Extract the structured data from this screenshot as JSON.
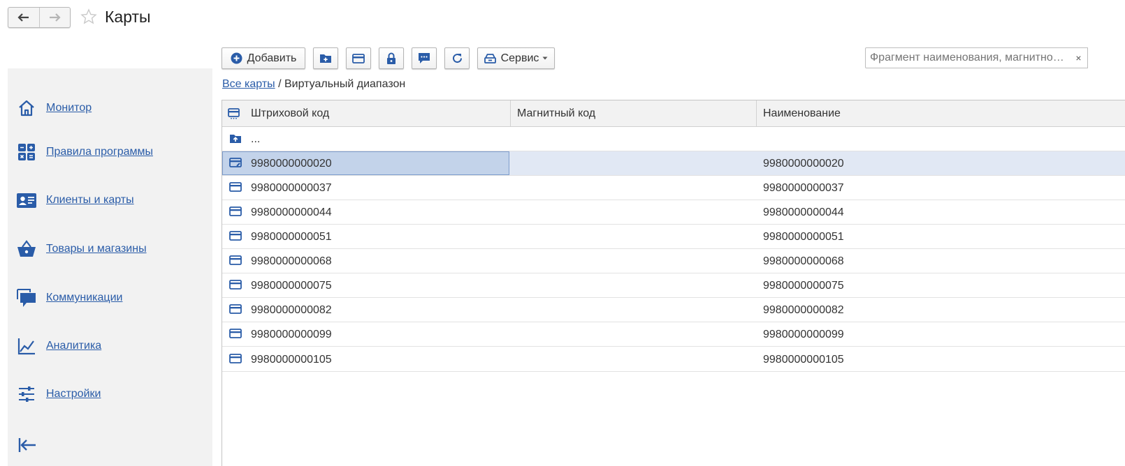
{
  "window": {
    "title": "Карты"
  },
  "sidebar": {
    "items": [
      {
        "label": "Монитор",
        "icon": "home-icon"
      },
      {
        "label": "Правила программы",
        "icon": "calculator-icon"
      },
      {
        "label": "Клиенты и карты",
        "icon": "id-card-icon"
      },
      {
        "label": "Товары и магазины",
        "icon": "basket-icon"
      },
      {
        "label": "Коммуникации",
        "icon": "chat-icon"
      },
      {
        "label": "Аналитика",
        "icon": "chart-icon"
      },
      {
        "label": "Настройки",
        "icon": "sliders-icon"
      }
    ]
  },
  "toolbar": {
    "add_label": "Добавить",
    "service_label": "Сервис",
    "search_placeholder": "Фрагмент наименования, магнитного кода...",
    "clear_label": "×"
  },
  "breadcrumb": {
    "root": "Все карты",
    "separator": " / ",
    "current": "Виртуальный диапазон"
  },
  "table": {
    "columns": [
      "Штриховой код",
      "Магнитный код",
      "Наименование"
    ],
    "up_label": "...",
    "rows": [
      {
        "barcode": "9980000000020",
        "magnetic": "",
        "name": "9980000000020"
      },
      {
        "barcode": "9980000000037",
        "magnetic": "",
        "name": "9980000000037"
      },
      {
        "barcode": "9980000000044",
        "magnetic": "",
        "name": "9980000000044"
      },
      {
        "barcode": "9980000000051",
        "magnetic": "",
        "name": "9980000000051"
      },
      {
        "barcode": "9980000000068",
        "magnetic": "",
        "name": "9980000000068"
      },
      {
        "barcode": "9980000000075",
        "magnetic": "",
        "name": "9980000000075"
      },
      {
        "barcode": "9980000000082",
        "magnetic": "",
        "name": "9980000000082"
      },
      {
        "barcode": "9980000000099",
        "magnetic": "",
        "name": "9980000000099"
      },
      {
        "barcode": "9980000000105",
        "magnetic": "",
        "name": "9980000000105"
      }
    ]
  },
  "colors": {
    "accent": "#2a5ca8",
    "selection": "#c3d3ea",
    "sidebar_bg": "#f2f2f2"
  }
}
